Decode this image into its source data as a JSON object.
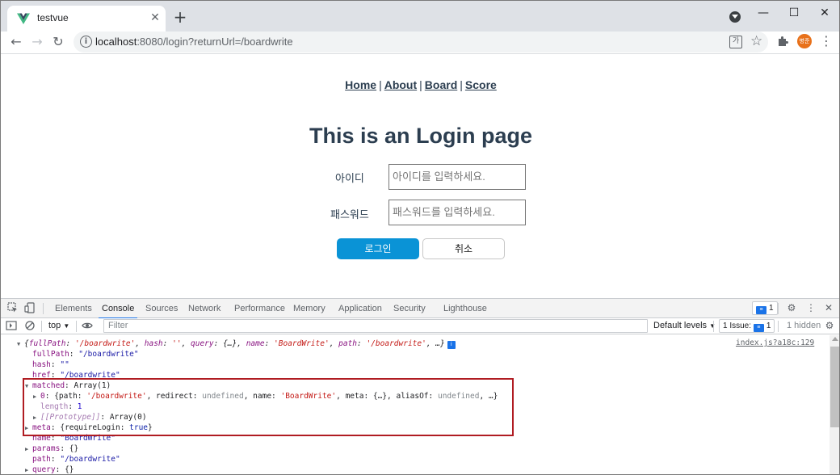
{
  "browser": {
    "tab_title": "testvue",
    "url_host": "localhost",
    "url_rest": ":8080/login?returnUrl=/boardwrite",
    "profile_initials": "병준",
    "new_tab_symbol": "+",
    "close_symbol": "✕",
    "window_controls": [
      "—",
      "☐",
      "✕"
    ]
  },
  "page": {
    "nav": [
      "Home",
      "About",
      "Board",
      "Score"
    ],
    "nav_separator": "|",
    "title": "This is an Login page",
    "id_label": "아이디",
    "id_placeholder": "아이디를 입력하세요.",
    "pw_label": "패스워드",
    "pw_placeholder": "패스워드를 입력하세요.",
    "login_button": "로그인",
    "cancel_button": "취소"
  },
  "devtools": {
    "tabs": [
      "Elements",
      "Console",
      "Sources",
      "Network",
      "Performance",
      "Memory",
      "Application",
      "Security",
      "Lighthouse"
    ],
    "active_tab": "Console",
    "message_count": "1",
    "context": "top",
    "filter_placeholder": "Filter",
    "levels": "Default levels",
    "issues": "1 Issue:",
    "issues_count": "1",
    "hidden": "1 hidden",
    "source_link": "index.js?a18c:129"
  },
  "console": {
    "summary": {
      "open": "{",
      "k1": "fullPath",
      "v1": "'/boardwrite'",
      "k2": "hash",
      "v2": "''",
      "k3": "query",
      "v3": "{…}",
      "k4": "name",
      "v4": "'BoardWrite'",
      "k5": "path",
      "v5": "'/boardwrite'",
      "tail": ", …}"
    },
    "fullPath_key": "fullPath",
    "fullPath_val": "\"/boardwrite\"",
    "hash_key": "hash",
    "hash_val": "\"\"",
    "href_key": "href",
    "href_val": "\"/boardwrite\"",
    "matched_key": "matched",
    "matched_val": "Array(1)",
    "item0_key": "0",
    "item0_open": "{path: ",
    "item0_path": "'/boardwrite'",
    "item0_redirect_label": ", redirect: ",
    "item0_redirect": "undefined",
    "item0_name_label": ", name: ",
    "item0_name": "'BoardWrite'",
    "item0_meta": ", meta: {…}, aliasOf: ",
    "item0_alias": "undefined",
    "item0_tail": ", …}",
    "length_key": "length",
    "length_val": "1",
    "proto_key": "[[Prototype]]",
    "proto_val": "Array(0)",
    "meta_key": "meta",
    "meta_open": "{requireLogin: ",
    "meta_true": "true",
    "meta_close": "}",
    "name_key": "name",
    "name_val": "\"BoardWrite\"",
    "params_key": "params",
    "params_val": "{}",
    "path_key": "path",
    "path_val": "\"/boardwrite\"",
    "query_key": "query",
    "query_val": "{}"
  },
  "colors": {
    "login_button": "#0a93d6",
    "highlight_box": "#b01c22",
    "accent": "#1a73e8"
  }
}
